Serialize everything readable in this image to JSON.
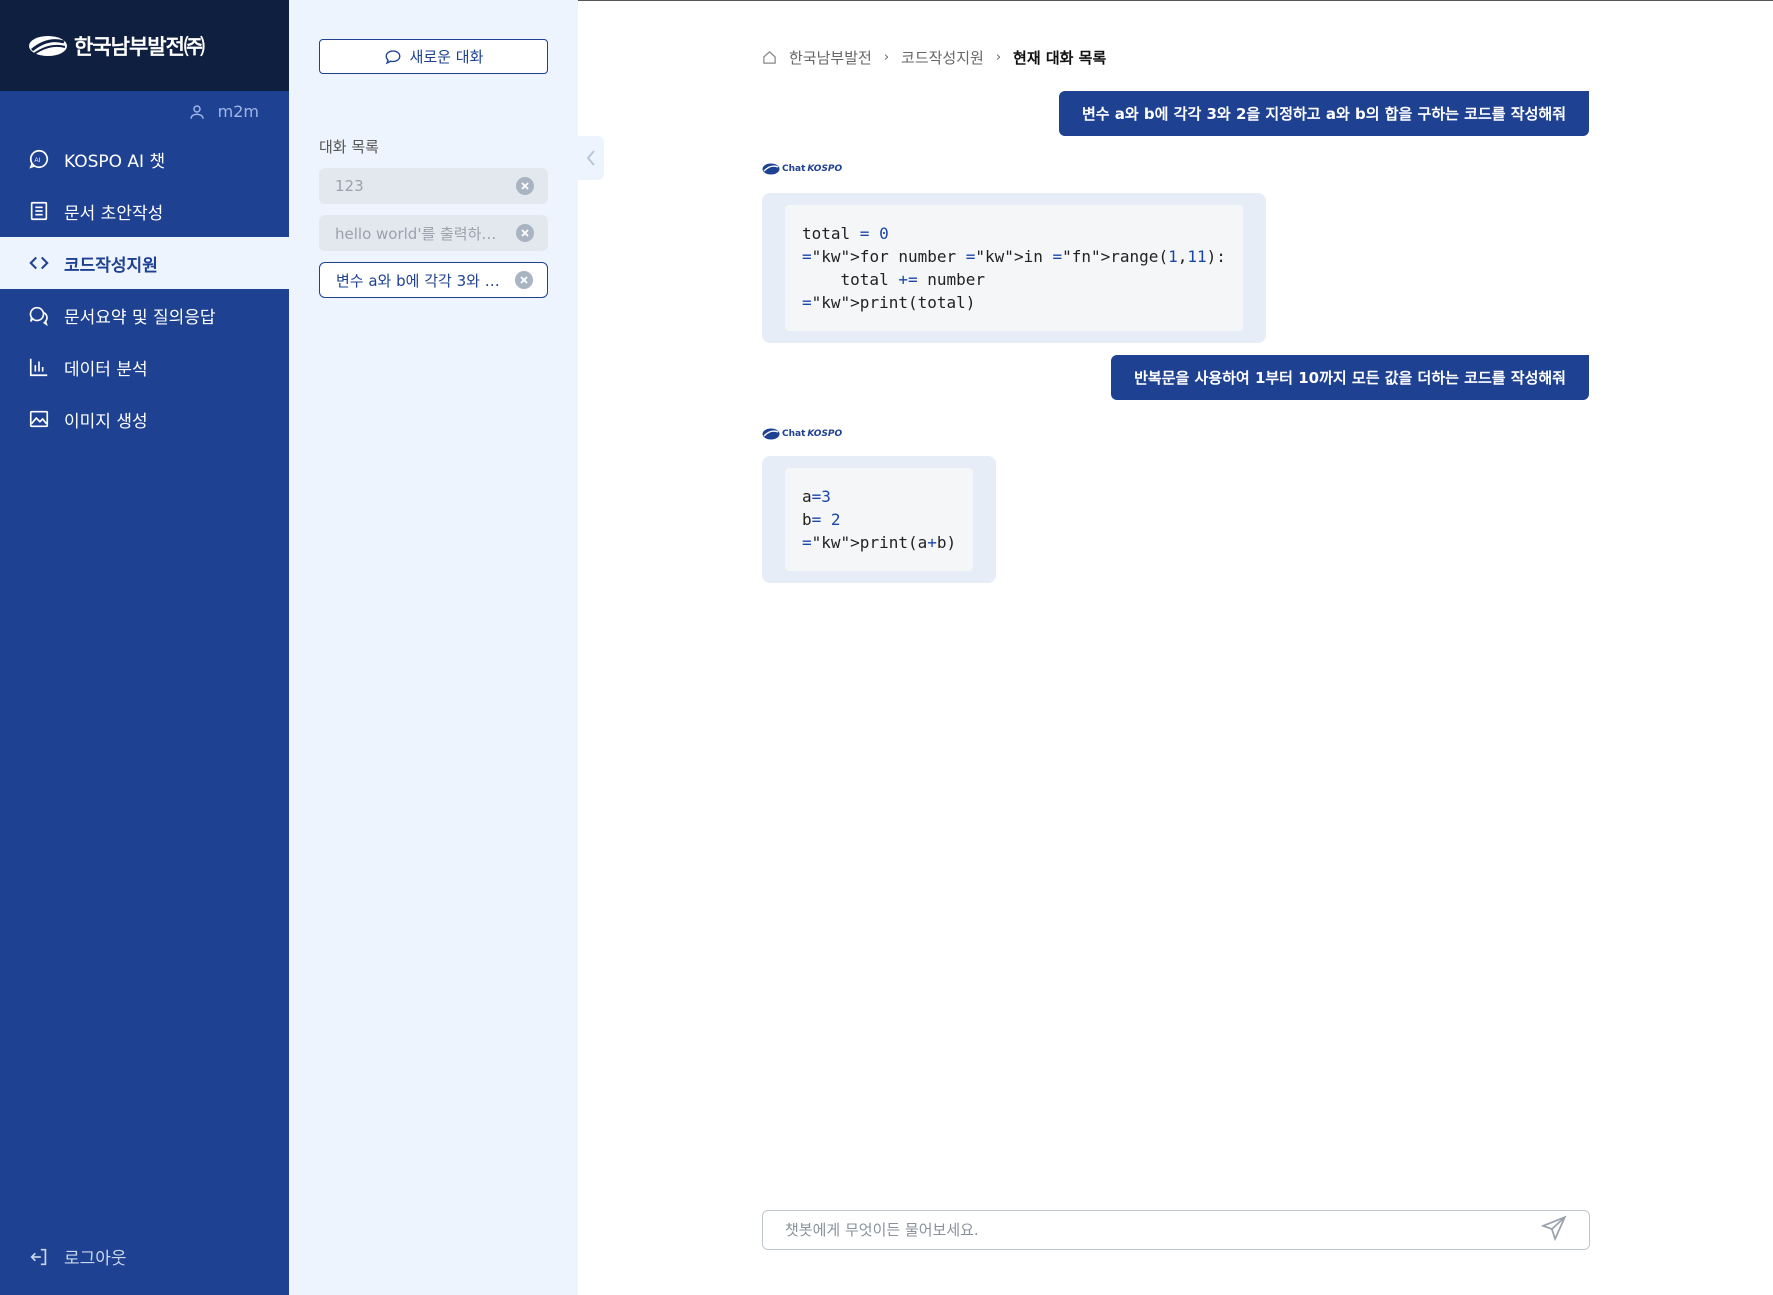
{
  "brand": {
    "logo_text": "한국남부발전㈜"
  },
  "user": {
    "name": "m2m"
  },
  "nav": {
    "items": [
      {
        "label": "KOSPO AI 챗",
        "icon": "ai-chat-icon",
        "active": false
      },
      {
        "label": "문서 초안작성",
        "icon": "document-icon",
        "active": false
      },
      {
        "label": "코드작성지원",
        "icon": "code-icon",
        "active": true
      },
      {
        "label": "문서요약 및 질의응답",
        "icon": "chat-bubbles-icon",
        "active": false
      },
      {
        "label": "데이터 분석",
        "icon": "bar-chart-icon",
        "active": false
      },
      {
        "label": "이미지 생성",
        "icon": "image-icon",
        "active": false
      }
    ],
    "logout_label": "로그아웃"
  },
  "conversations": {
    "new_chat_label": "새로운 대화",
    "title": "대화 목록",
    "items": [
      {
        "label": "123",
        "active": false
      },
      {
        "label": "hello world'를 출력하…",
        "active": false
      },
      {
        "label": "변수 a와 b에 각각 3와 2…",
        "active": true
      }
    ]
  },
  "breadcrumb": {
    "home": "한국남부발전",
    "section": "코드작성지원",
    "current": "현재 대화 목록"
  },
  "messages": {
    "user1": "변수 a와 b에 각각 3와 2을 지정하고 a와 b의 합을 구하는 코드를 작성해줘",
    "user2": "반복문을 사용하여 1부터 10까지 모든 값을 더하는 코드를 작성해줘",
    "bot_badge_chat": "Chat",
    "bot_badge_brand": "KOSPO",
    "code1": "total = 0\nfor number in range(1,11):\n    total += number\nprint(total)",
    "code2": "a=3\nb= 2\nprint(a+b)"
  },
  "input": {
    "placeholder": "챗봇에게 무엇이든 물어보세요."
  },
  "colors": {
    "primary": "#1e4192",
    "logo_bar": "#0f1f3f",
    "panel_bg": "#eef4fd"
  }
}
